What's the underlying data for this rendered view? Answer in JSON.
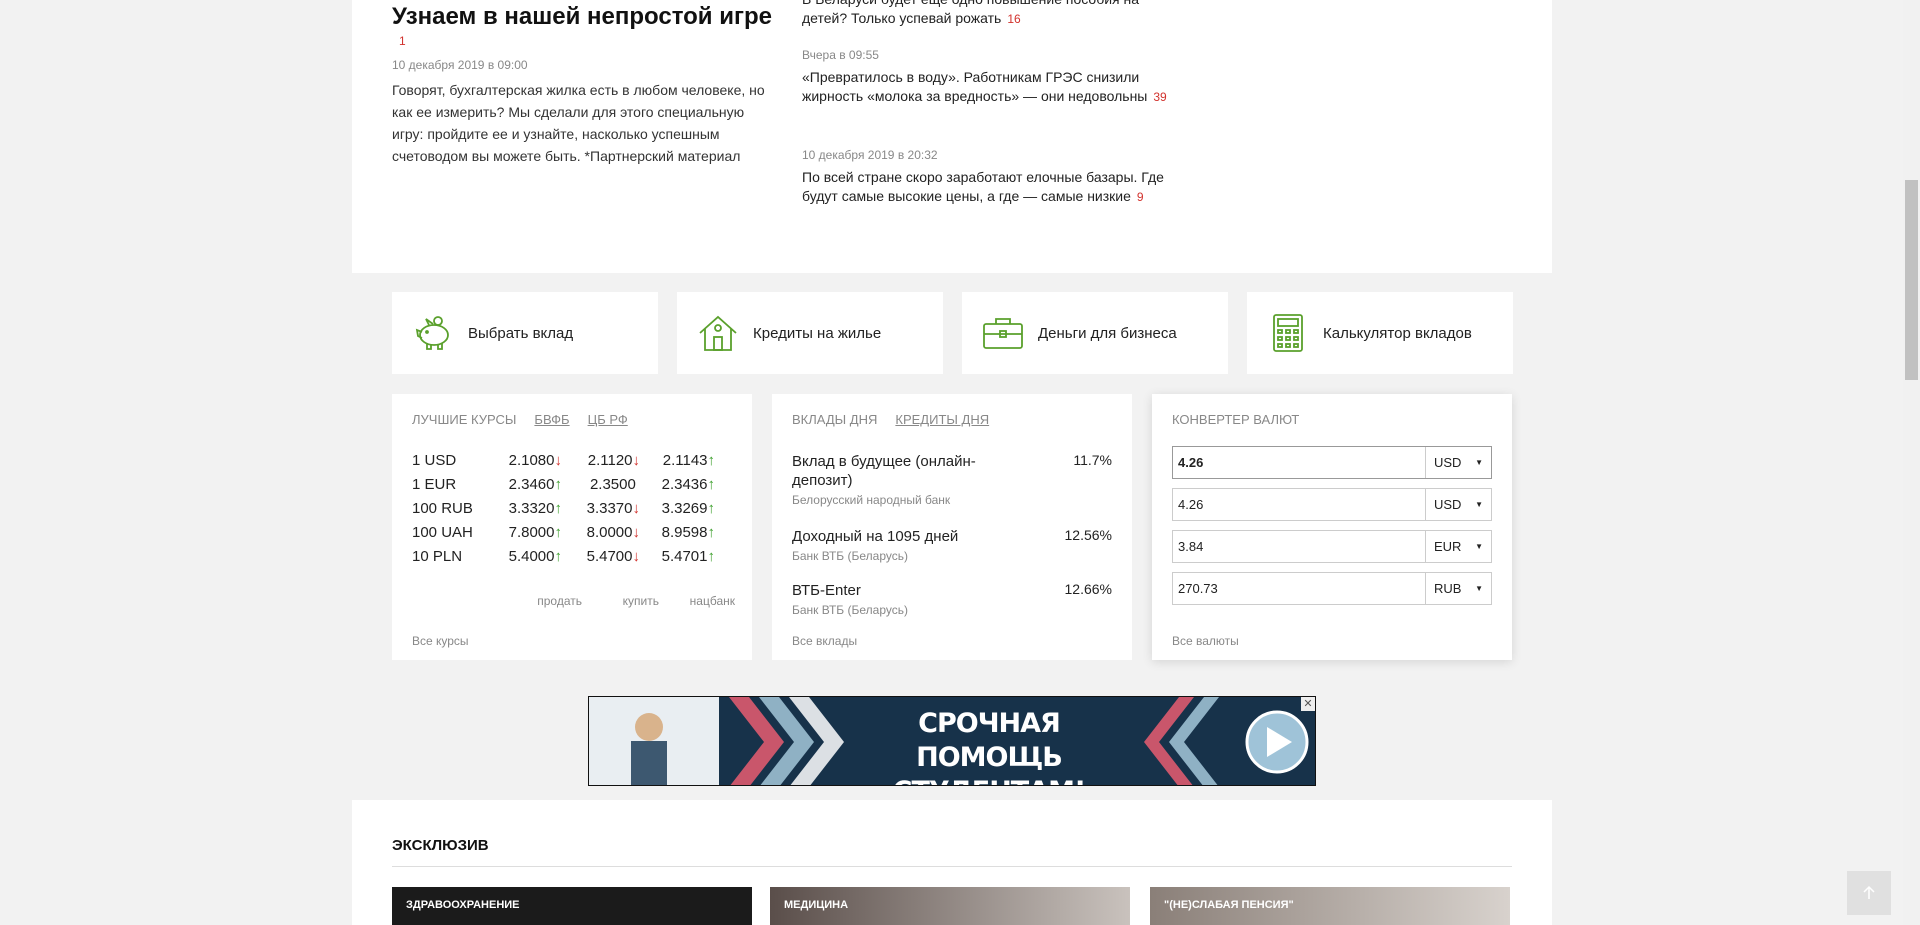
{
  "lead": {
    "title": "Узнаем в нашей непростой игре",
    "comments": "1",
    "date": "10 декабря 2019 в 09:00",
    "text": "Говорят, бухгалтерская жилка есть в любом человеке, но как ее измерить? Мы сделали для этого специальную игру: пройдите ее и узнайте, насколько успешным счетоводом вы можете быть. *Партнерский материал"
  },
  "side_news": [
    {
      "date": "",
      "text": "В Беларуси будет еще одно повышение пособия на детей? Только успевай рожать",
      "comments": "16"
    },
    {
      "date": "Вчера в 09:55",
      "text": "«Превратилось в воду». Работникам ГРЭС снизили жирность «молока за вредность» — они недовольны",
      "comments": "39"
    },
    {
      "date": "10 декабря 2019 в 20:32",
      "text": "По всей стране скоро заработают елочные базары. Где будут самые высокие цены, а где — самые низкие",
      "comments": "9"
    }
  ],
  "quick_links": [
    {
      "label": "Выбрать вклад",
      "icon": "piggy-bank-icon"
    },
    {
      "label": "Кредиты на жилье",
      "icon": "house-icon"
    },
    {
      "label": "Деньги для бизнеса",
      "icon": "briefcase-icon"
    },
    {
      "label": "Калькулятор вкладов",
      "icon": "calculator-icon"
    }
  ],
  "rates": {
    "tabs": {
      "active": "ЛУЧШИЕ КУРСЫ",
      "tab2": "БВФБ",
      "tab3": "ЦБ РФ"
    },
    "rows": [
      {
        "cur": "1 USD",
        "sell": "2.1080",
        "sell_dir": "down",
        "buy": "2.1120",
        "buy_dir": "down",
        "nb": "2.1143",
        "nb_dir": "up"
      },
      {
        "cur": "1 EUR",
        "sell": "2.3460",
        "sell_dir": "up",
        "buy": "2.3500",
        "buy_dir": "",
        "nb": "2.3436",
        "nb_dir": "up"
      },
      {
        "cur": "100 RUB",
        "sell": "3.3320",
        "sell_dir": "up",
        "buy": "3.3370",
        "buy_dir": "down",
        "nb": "3.3269",
        "nb_dir": "up"
      },
      {
        "cur": "100 UAH",
        "sell": "7.8000",
        "sell_dir": "up",
        "buy": "8.0000",
        "buy_dir": "down",
        "nb": "8.9598",
        "nb_dir": "up"
      },
      {
        "cur": "10 PLN",
        "sell": "5.4000",
        "sell_dir": "up",
        "buy": "5.4700",
        "buy_dir": "down",
        "nb": "5.4701",
        "nb_dir": "up"
      }
    ],
    "labels": {
      "sell": "продать",
      "buy": "купить",
      "nb": "нацбанк"
    },
    "footer": "Все курсы"
  },
  "deposits": {
    "tabs": {
      "active": "ВКЛАДЫ ДНЯ",
      "tab2": "КРЕДИТЫ ДНЯ"
    },
    "items": [
      {
        "name": "Вклад в будущее (онлайн-депозит)",
        "bank": "Белорусский народный банк",
        "rate": "11.7%"
      },
      {
        "name": "Доходный на 1095 дней",
        "bank": "Банк ВТБ (Беларусь)",
        "rate": "12.56%"
      },
      {
        "name": "ВТБ-Enter",
        "bank": "Банк ВТБ (Беларусь)",
        "rate": "12.66%"
      }
    ],
    "footer": "Все вклады"
  },
  "converter": {
    "title": "КОНВЕРТЕР ВАЛЮТ",
    "rows": [
      {
        "value": "4.26",
        "currency": "USD"
      },
      {
        "value": "4.26",
        "currency": "USD"
      },
      {
        "value": "3.84",
        "currency": "EUR"
      },
      {
        "value": "270.73",
        "currency": "RUB"
      }
    ],
    "footer": "Все валюты"
  },
  "banner": {
    "text": "СРОЧНАЯ ПОМОЩЬ СТУДЕНТАМ!",
    "close": "✕"
  },
  "exclusive": {
    "title": "ЭКСКЛЮЗИВ",
    "cards": [
      {
        "label": "ЗДРАВООХРАНЕНИЕ"
      },
      {
        "label": "МЕДИЦИНА"
      },
      {
        "label": "\"(НЕ)СЛАБАЯ ПЕНСИЯ\""
      }
    ]
  },
  "colors": {
    "accent_green": "#5aa02c",
    "comment_red": "#d2322d",
    "up_green": "#3ea02f"
  }
}
